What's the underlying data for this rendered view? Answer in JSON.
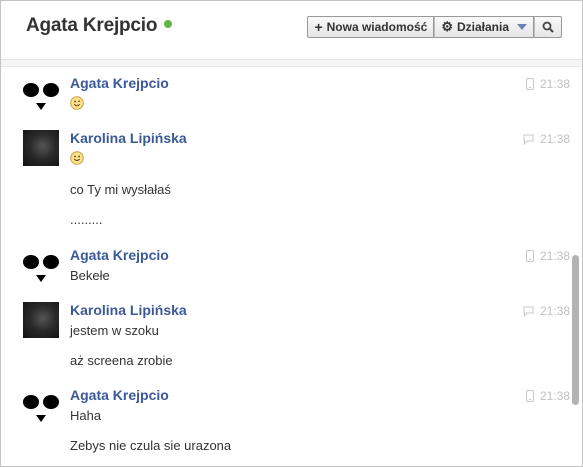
{
  "header": {
    "title": "Agata Krejpcio",
    "new_message_label": "Nowa wiadomość",
    "actions_label": "Działania"
  },
  "messages": [
    {
      "sender": "Agata Krejpcio",
      "time": "21:38",
      "lines": [
        ":)"
      ],
      "avatar": "panda",
      "time_icon": "mobile-icon"
    },
    {
      "sender": "Karolina Lipińska",
      "time": "21:38",
      "lines": [
        ":)",
        "co Ty mi wysłałaś",
        "........."
      ],
      "avatar": "photo",
      "time_icon": "chat-bubble-icon"
    },
    {
      "sender": "Agata Krejpcio",
      "time": "21:38",
      "lines": [
        "Bekełe"
      ],
      "avatar": "panda",
      "time_icon": "mobile-icon"
    },
    {
      "sender": "Karolina Lipińska",
      "time": "21:38",
      "lines": [
        "jestem w szoku",
        "aż screena zrobie"
      ],
      "avatar": "photo",
      "time_icon": "chat-bubble-icon"
    },
    {
      "sender": "Agata Krejpcio",
      "time": "21:38",
      "lines": [
        "Haha",
        "Zebys nie czula sie urazona"
      ],
      "avatar": "panda",
      "time_icon": "mobile-icon"
    }
  ],
  "colors": {
    "sender": "#3b5998",
    "online": "#63b543",
    "time": "#c0c0c0"
  }
}
